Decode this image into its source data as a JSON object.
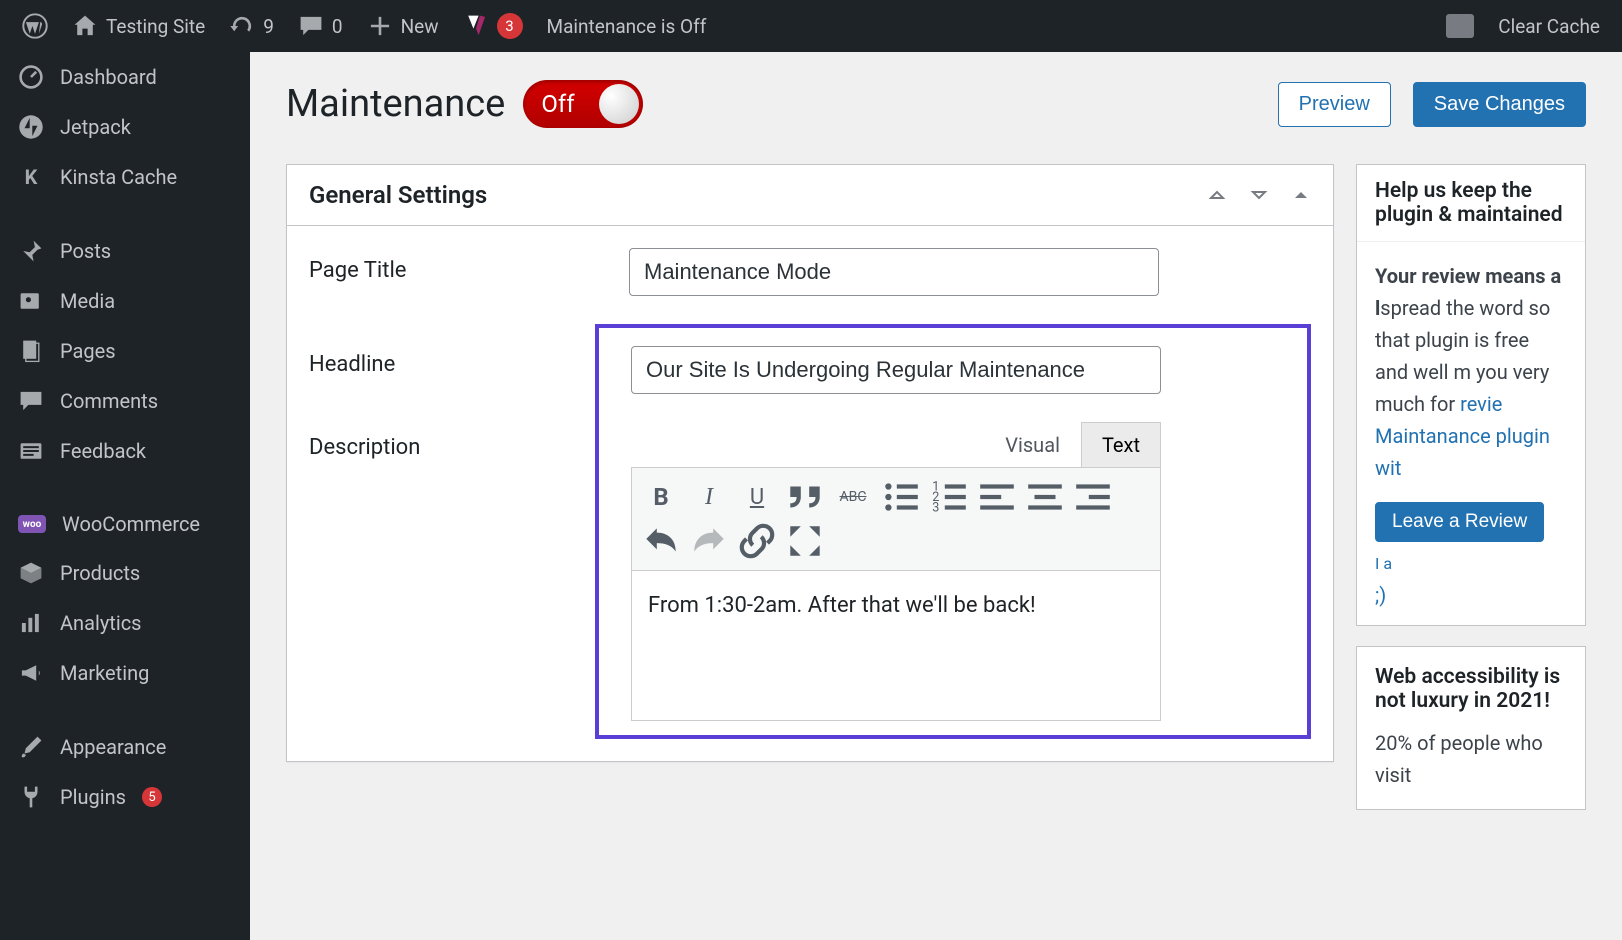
{
  "adminbar": {
    "site_name": "Testing Site",
    "updates_count": "9",
    "comments_count": "0",
    "new_label": "New",
    "yoast_count": "3",
    "maintenance_status": "Maintenance is Off",
    "clear_cache": "Clear Cache"
  },
  "sidebar": {
    "items": [
      {
        "label": "Dashboard"
      },
      {
        "label": "Jetpack"
      },
      {
        "label": "Kinsta Cache"
      },
      {
        "label": "Posts"
      },
      {
        "label": "Media"
      },
      {
        "label": "Pages"
      },
      {
        "label": "Comments"
      },
      {
        "label": "Feedback"
      },
      {
        "label": "WooCommerce"
      },
      {
        "label": "Products"
      },
      {
        "label": "Analytics"
      },
      {
        "label": "Marketing"
      },
      {
        "label": "Appearance"
      },
      {
        "label": "Plugins"
      }
    ],
    "plugins_badge": "5"
  },
  "page": {
    "title": "Maintenance",
    "toggle_state": "Off",
    "preview_btn": "Preview",
    "save_btn": "Save Changes"
  },
  "panel": {
    "title": "General Settings",
    "page_title_label": "Page Title",
    "page_title_value": "Maintenance Mode",
    "headline_label": "Headline",
    "headline_value": "Our Site Is Undergoing Regular Maintenance",
    "description_label": "Description",
    "visual_tab": "Visual",
    "text_tab": "Text",
    "description_value": "From 1:30-2am. After that we'll be back!"
  },
  "side1": {
    "title": "Help us keep the plugin & maintained",
    "bold": "Your review means a l",
    "text1": "spread the word so that plugin is free and well m you very much for ",
    "link1": "revie",
    "link2": "Maintanance plugin wit",
    "review_btn": "Leave a Review",
    "already": "I a",
    "wink": ";)"
  },
  "side2": {
    "title": "Web accessibility is not luxury in 2021!",
    "stat": "20% of people who visit"
  }
}
